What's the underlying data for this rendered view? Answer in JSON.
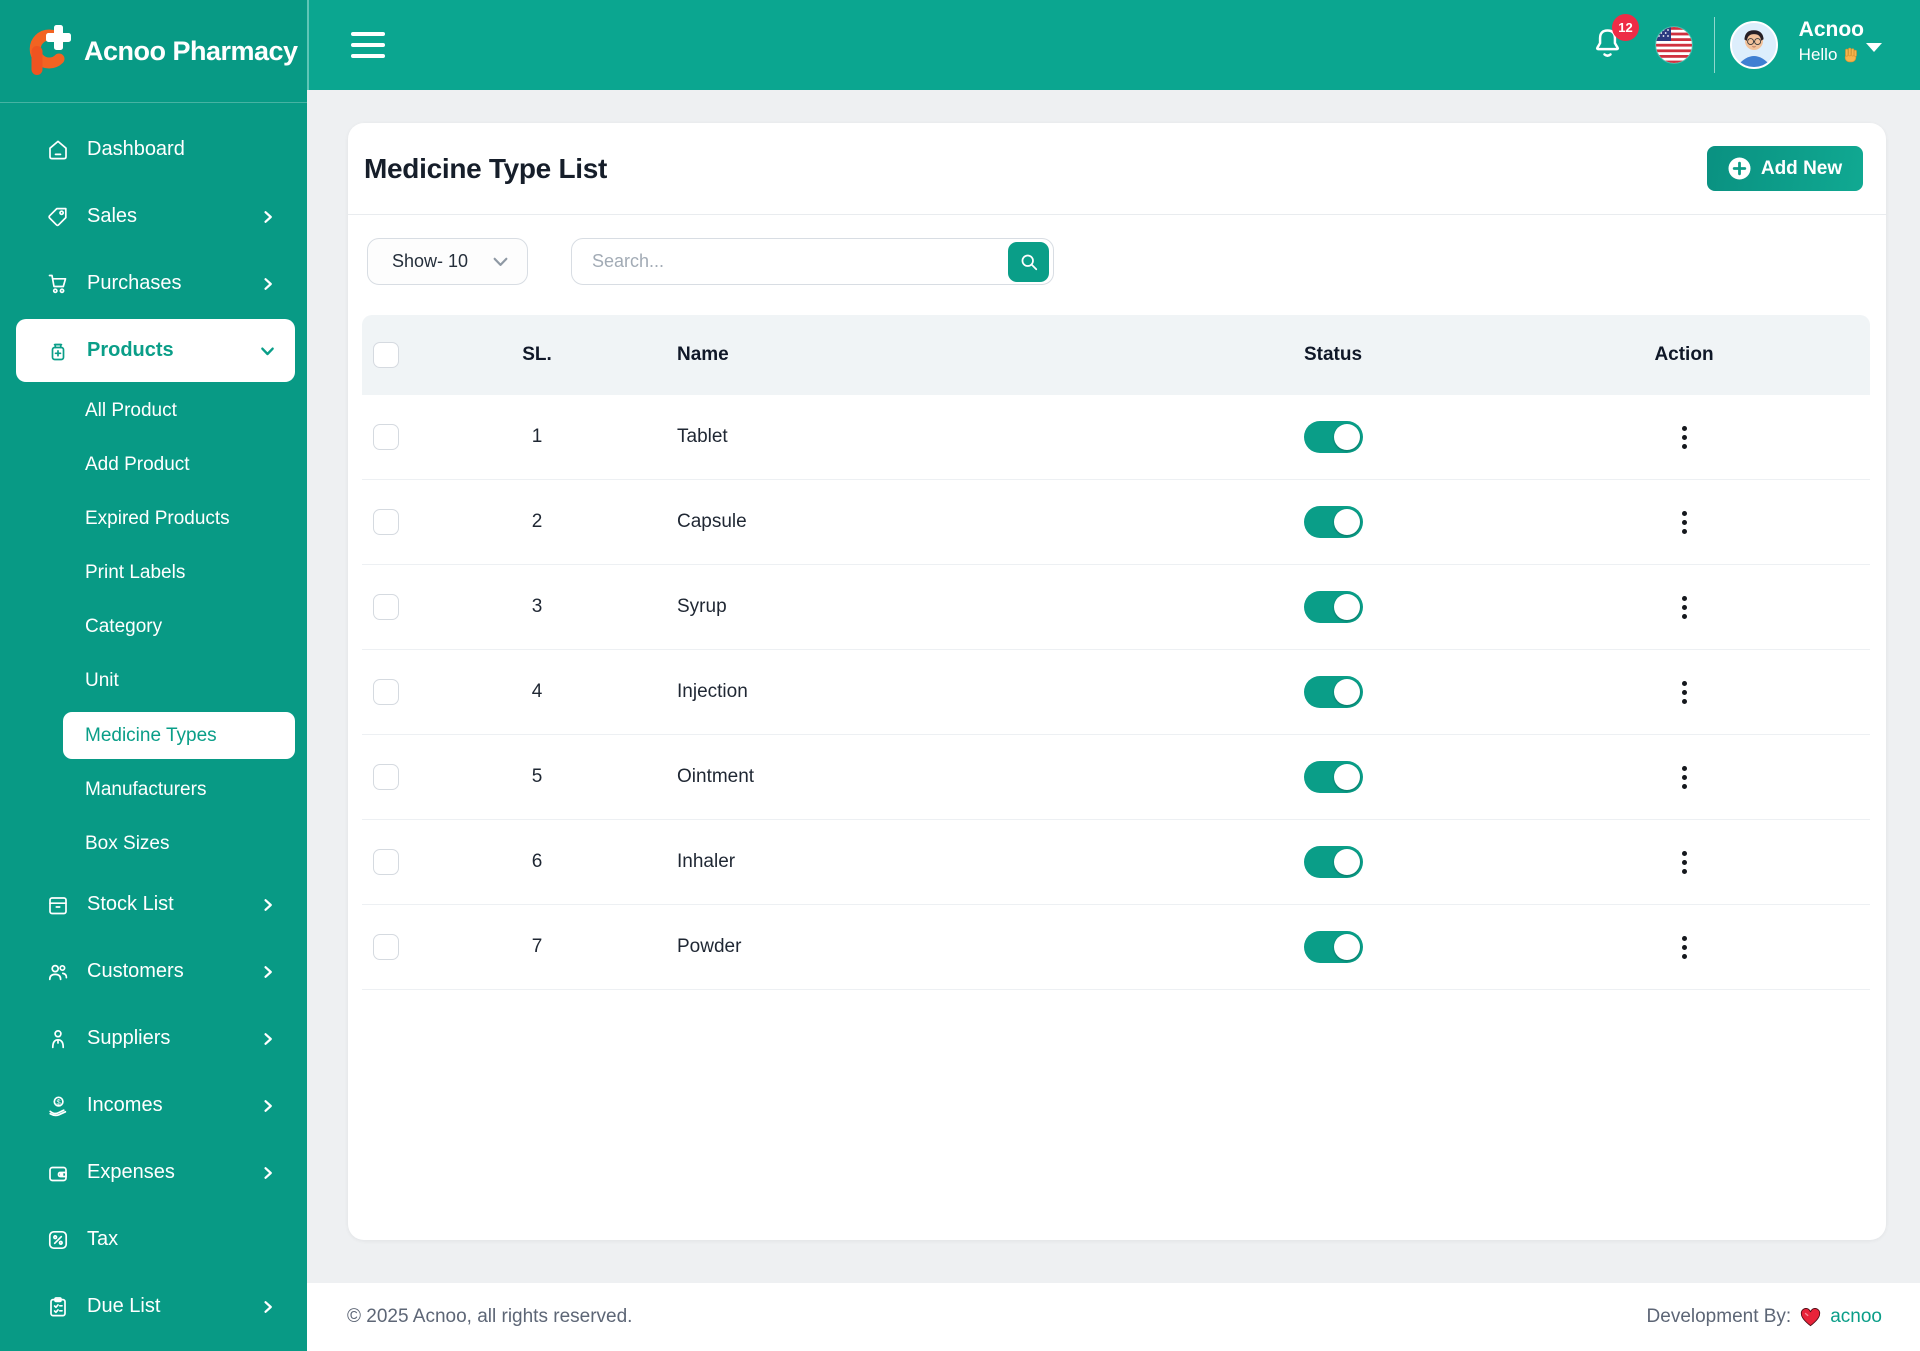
{
  "brand": {
    "name": "Acnoo Pharmacy"
  },
  "topbar": {
    "notification_count": "12",
    "user": {
      "name": "Acnoo",
      "greeting": "Hello"
    }
  },
  "sidebar": {
    "items": [
      {
        "label": "Dashboard"
      },
      {
        "label": "Sales"
      },
      {
        "label": "Purchases"
      },
      {
        "label": "Products"
      },
      {
        "label": "All Product"
      },
      {
        "label": "Add Product"
      },
      {
        "label": "Expired Products"
      },
      {
        "label": "Print Labels"
      },
      {
        "label": "Category"
      },
      {
        "label": "Unit"
      },
      {
        "label": "Medicine Types"
      },
      {
        "label": "Manufacturers"
      },
      {
        "label": "Box Sizes"
      },
      {
        "label": "Stock List"
      },
      {
        "label": "Customers"
      },
      {
        "label": "Suppliers"
      },
      {
        "label": "Incomes"
      },
      {
        "label": "Expenses"
      },
      {
        "label": "Tax"
      },
      {
        "label": "Due List"
      }
    ]
  },
  "page": {
    "title": "Medicine Type List",
    "add_new_label": "Add New"
  },
  "controls": {
    "show_label": "Show- 10",
    "search_placeholder": "Search..."
  },
  "table": {
    "headers": {
      "sl": "SL.",
      "name": "Name",
      "status": "Status",
      "action": "Action"
    },
    "rows": [
      {
        "sl": "1",
        "name": "Tablet",
        "status_on": true
      },
      {
        "sl": "2",
        "name": "Capsule",
        "status_on": true
      },
      {
        "sl": "3",
        "name": "Syrup",
        "status_on": true
      },
      {
        "sl": "4",
        "name": "Injection",
        "status_on": true
      },
      {
        "sl": "5",
        "name": "Ointment",
        "status_on": true
      },
      {
        "sl": "6",
        "name": "Inhaler",
        "status_on": true
      },
      {
        "sl": "7",
        "name": "Powder",
        "status_on": true
      }
    ]
  },
  "footer": {
    "copyright": "© 2025 Acnoo, all rights reserved.",
    "dev_by_label": "Development By:",
    "dev_link": "acnoo"
  },
  "colors": {
    "primary": "#0a9e88",
    "sidebar_bg": "#089a85",
    "topbar_bg": "#0ba690",
    "badge_red": "#ee2c46",
    "logo_orange": "#f26322"
  }
}
